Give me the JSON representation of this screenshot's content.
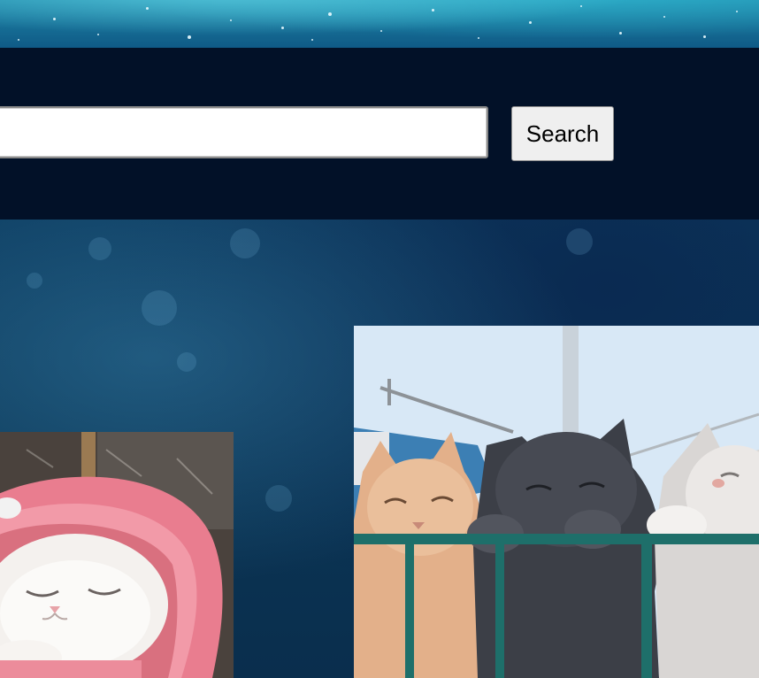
{
  "search": {
    "placeholder": "",
    "value": "",
    "button_label": "Search"
  },
  "images": [
    {
      "name": "cat-in-pink-hoodie-image",
      "alt": ""
    },
    {
      "name": "three-cats-on-railing-image",
      "alt": ""
    }
  ],
  "colors": {
    "search_band": "#021128",
    "top_band": "#1f86a8",
    "space_background": "#0b3656",
    "button_bg": "#efefef"
  }
}
